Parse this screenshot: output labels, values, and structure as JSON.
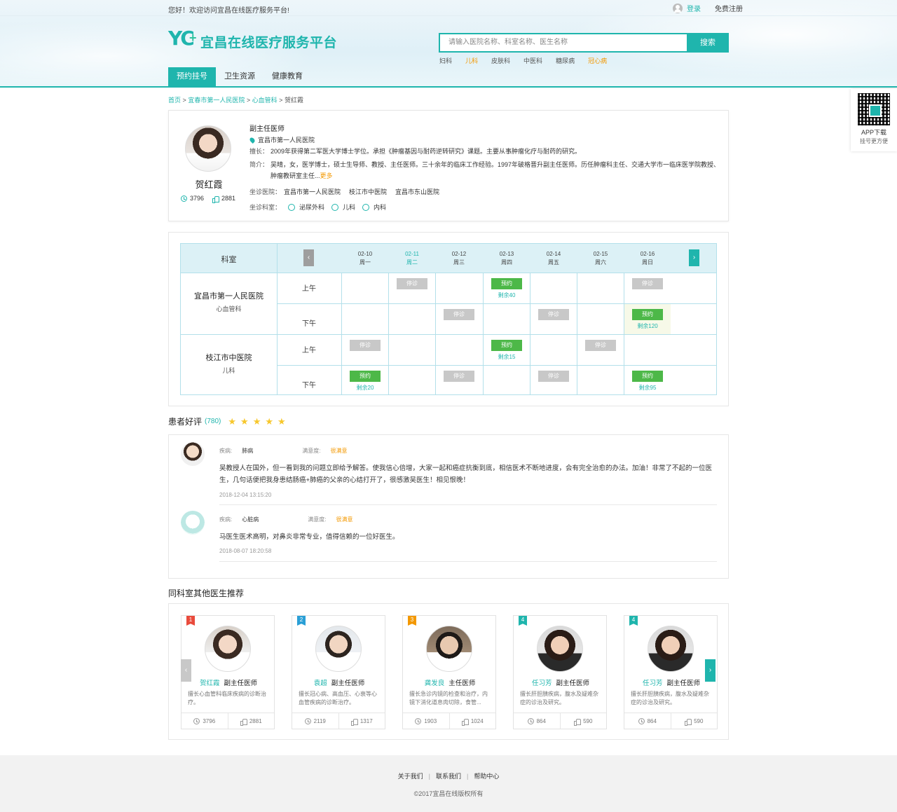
{
  "topbar": {
    "welcome": "您好！欢迎访问宜昌在线医疗服务平台!",
    "login": "登录",
    "register": "免费注册"
  },
  "logo": {
    "mark": "YC",
    "plus": "+",
    "text": "宜昌在线医疗服务平台"
  },
  "search": {
    "placeholder": "请输入医院名称、科室名称、医生名称",
    "button": "搜索",
    "tags": [
      {
        "t": "妇科",
        "hl": false
      },
      {
        "t": "儿科",
        "hl": true
      },
      {
        "t": "皮肤科",
        "hl": false
      },
      {
        "t": "中医科",
        "hl": false
      },
      {
        "t": "糖尿病",
        "hl": false
      },
      {
        "t": "冠心病",
        "hl": true
      }
    ]
  },
  "nav": [
    "预约挂号",
    "卫生资源",
    "健康教育"
  ],
  "qr": {
    "title": "APP下载",
    "sub": "挂号更方便"
  },
  "breadcrumb": {
    "home": "首页",
    "hospital": "宜春市第一人民医院",
    "dept": "心血管科",
    "current": "贺红霞",
    "sep": ">"
  },
  "doctor": {
    "name": "贺红霞",
    "visits": "3796",
    "likes": "2881",
    "title": "副主任医师",
    "hospital": "宜昌市第一人民医院",
    "specialty_label": "擅长：",
    "specialty": "2009年获得第二军医大学博士学位。承担《肿瘤基因与耐药逆转研究》课题。主要从事肿瘤化疗与耐药的研究。",
    "intro_label": "简介：",
    "intro": "吴晴，女，医学博士，硕士生导师、教授、主任医师。三十余年的临床工作经验。1997年破格晋升副主任医师。历任肿瘤科主任、交通大学市一临床医学院教授、肿瘤教研室主任...",
    "more": "更多",
    "sit_hosp_label": "坐诊医院：",
    "sit_hospitals": [
      "宜昌市第一人民医院",
      "枝江市中医院",
      "宜昌市东山医院"
    ],
    "sit_dept_label": "坐诊科室：",
    "sit_depts": [
      "泌尿外科",
      "儿科",
      "内科"
    ]
  },
  "schedule": {
    "dept_header": "科室",
    "arrow_left": "‹",
    "arrow_right": "›",
    "dates": [
      {
        "d": "02-10",
        "w": "周一",
        "today": false
      },
      {
        "d": "02-11",
        "w": "周二",
        "today": true
      },
      {
        "d": "02-12",
        "w": "周三",
        "today": false
      },
      {
        "d": "02-13",
        "w": "周四",
        "today": false
      },
      {
        "d": "02-14",
        "w": "周五",
        "today": false
      },
      {
        "d": "02-15",
        "w": "周六",
        "today": false
      },
      {
        "d": "02-16",
        "w": "周日",
        "today": false
      }
    ],
    "am": "上午",
    "pm": "下午",
    "off_label": "停诊",
    "book_label": "预约",
    "hospitals": [
      {
        "name": "宜昌市第一人民医院",
        "dept": "心血管科",
        "am": [
          null,
          "off",
          null,
          {
            "book": "剩余40"
          },
          null,
          null,
          "off"
        ],
        "pm": [
          null,
          null,
          "off",
          null,
          "off",
          null,
          {
            "book": "剩余120"
          }
        ]
      },
      {
        "name": "枝江市中医院",
        "dept": "儿科",
        "am": [
          "off",
          null,
          null,
          {
            "book": "剩余15"
          },
          null,
          "off",
          null
        ],
        "pm": [
          {
            "book": "剩余20"
          },
          null,
          "off",
          null,
          "off",
          null,
          {
            "book": "剩余95"
          }
        ]
      }
    ]
  },
  "reviews": {
    "title": "患者好评",
    "count": "(780)",
    "stars": 5,
    "disease_label": "疾病:",
    "satisfaction_label": "满意度:",
    "items": [
      {
        "disease": "肺病",
        "satisfaction": "很满意",
        "text": "吴教授人在国外，但一看到我的问题立即给予解答。使我信心倍增，大家一起和癌症抗衡到底，相信医术不断地进度，会有完全治愈的办法。加油！非常了不起的一位医生，几句话便把我身患结肠癌+肺癌的父亲的心结打开了，很感激吴医生！相见恨晚！",
        "time": "2018-12-04   13:15:20"
      },
      {
        "disease": "心脏病",
        "satisfaction": "很满意",
        "text": "马医生医术高明，对鼻炎非常专业，值得信赖的一位好医生。",
        "time": "2018-08-07   18:20:58"
      }
    ]
  },
  "recommend": {
    "title": "同科室其他医生推荐",
    "arrow_left": "‹",
    "arrow_right": "›",
    "doctors": [
      {
        "rank": "1",
        "rank_color": "#e94b3c",
        "name": "贺红霞",
        "title": "副主任医师",
        "desc": "擅长心血管科临床疾病的诊断治疗。",
        "visits": "3796",
        "likes": "2881"
      },
      {
        "rank": "2",
        "rank_color": "#2a9fd6",
        "name": "袁超",
        "title": "副主任医师",
        "desc": "擅长冠心病、高血压、心衰等心血管疾病的诊断治疗。",
        "visits": "2119",
        "likes": "1317"
      },
      {
        "rank": "3",
        "rank_color": "#f39800",
        "name": "龚发良",
        "title": "主任医师",
        "desc": "擅长急诊内镜的检查和治疗，内镜下消化道息肉切除，食管...",
        "visits": "1903",
        "likes": "1024"
      },
      {
        "rank": "4",
        "rank_color": "#1fb5ad",
        "name": "任习芳",
        "title": "副主任医师",
        "desc": "擅长肝胆胰疾病，腹水及疑难杂症的诊治及研究。",
        "visits": "864",
        "likes": "590"
      },
      {
        "rank": "4",
        "rank_color": "#1fb5ad",
        "name": "任习芳",
        "title": "副主任医师",
        "desc": "擅长肝胆胰疾病，腹水及疑难杂症的诊治及研究。",
        "visits": "864",
        "likes": "590"
      }
    ]
  },
  "footer": {
    "links": [
      "关于我们",
      "联系我们",
      "帮助中心"
    ],
    "sep": "|",
    "copyright": "©2017宜昌在线版权所有"
  }
}
